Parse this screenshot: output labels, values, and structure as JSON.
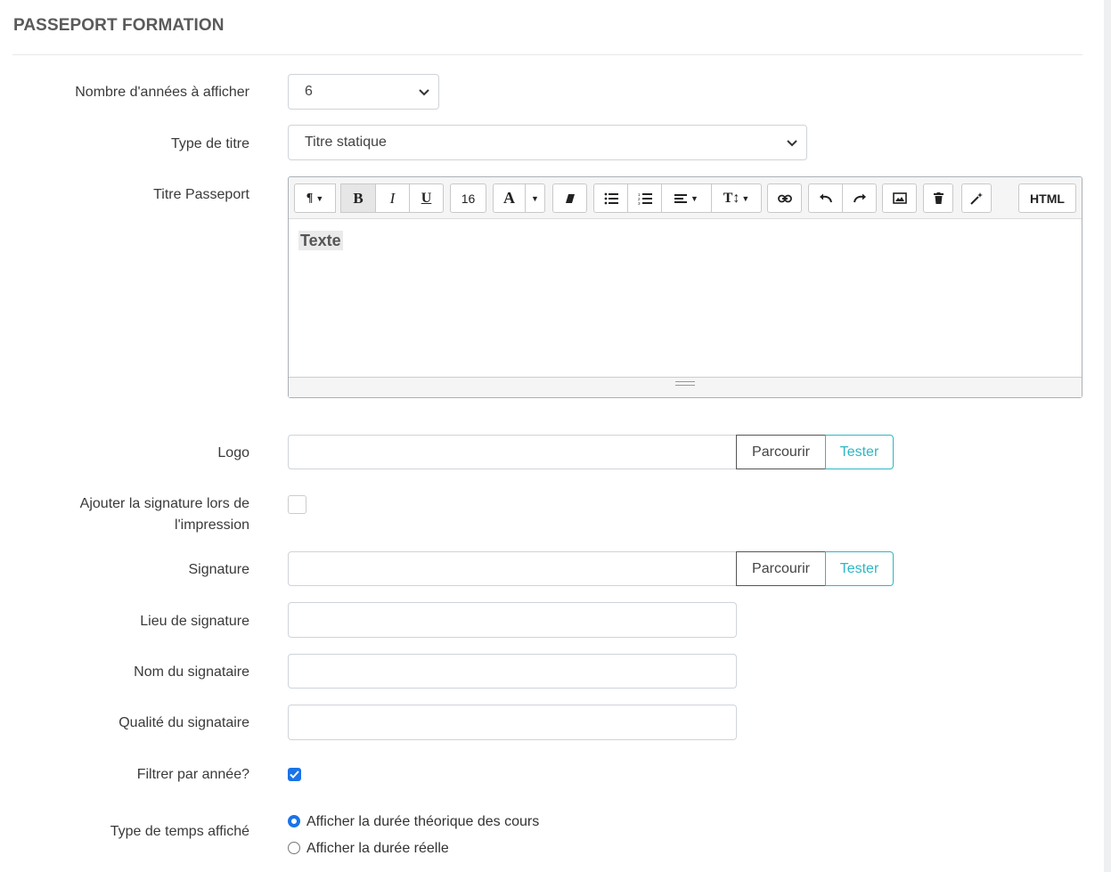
{
  "section": {
    "title": "PASSEPORT FORMATION"
  },
  "years": {
    "label": "Nombre d'années à afficher",
    "value": "6"
  },
  "title_type": {
    "label": "Type de titre",
    "value": "Titre statique"
  },
  "titre_passeport": {
    "label": "Titre Passeport",
    "toolbar": {
      "font_size": "16",
      "html_label": "HTML",
      "icons": [
        "paragraph-icon",
        "bold-icon",
        "italic-icon",
        "underline-icon",
        "font-color-icon",
        "eraser-icon",
        "unordered-list-icon",
        "ordered-list-icon",
        "align-icon",
        "line-height-icon",
        "link-icon",
        "undo-icon",
        "redo-icon",
        "image-icon",
        "trash-icon",
        "magic-wand-icon"
      ]
    },
    "content": "Texte"
  },
  "logo": {
    "label": "Logo",
    "browse": "Parcourir",
    "test": "Tester"
  },
  "add_signature": {
    "label_line1": "Ajouter la signature lors de",
    "label_line2": "l'impression",
    "checked": false
  },
  "signature": {
    "label": "Signature",
    "browse": "Parcourir",
    "test": "Tester"
  },
  "lieu": {
    "label": "Lieu de signature",
    "value": ""
  },
  "nom": {
    "label": "Nom du signataire",
    "value": ""
  },
  "qualite": {
    "label": "Qualité du signataire",
    "value": ""
  },
  "filter_year": {
    "label": "Filtrer par année?",
    "checked": true
  },
  "time_type": {
    "label": "Type de temps affiché",
    "options": [
      "Afficher la durée théorique des cours",
      "Afficher la durée réelle"
    ],
    "selected": "Afficher la durée théorique des cours"
  },
  "colors": {
    "accent": "#2db7c4",
    "checkbox": "#1a73e8"
  }
}
